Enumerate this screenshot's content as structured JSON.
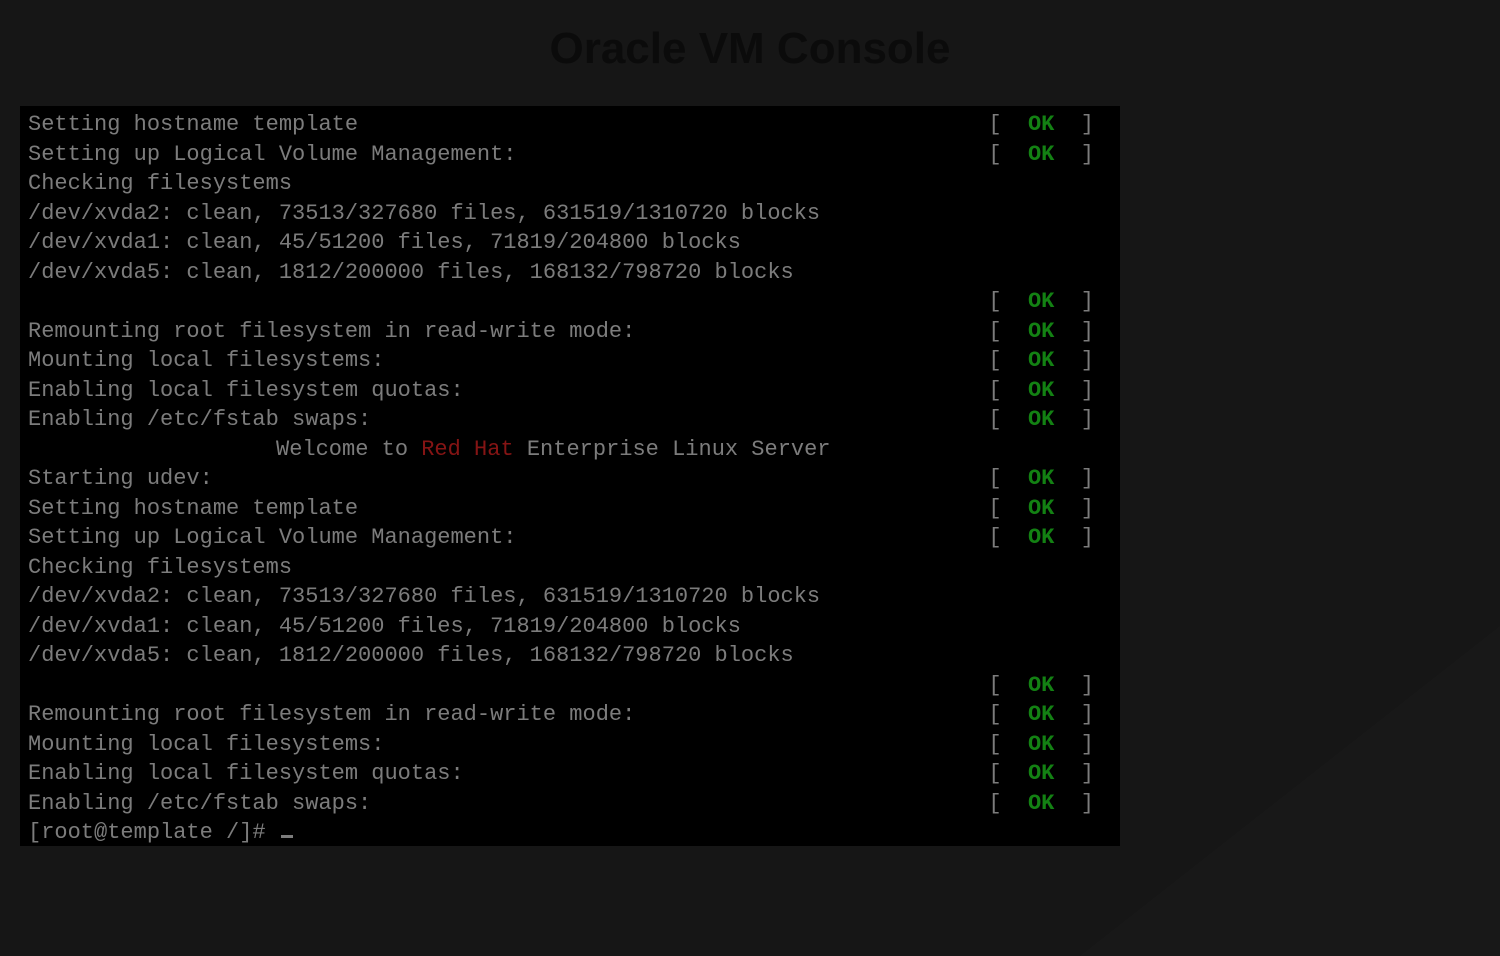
{
  "title": "Oracle VM Console",
  "status_ok": "OK",
  "bracket_open": "[",
  "bracket_close": "]",
  "welcome": {
    "prefix": "Welcome to ",
    "highlight": "Red Hat",
    "suffix": " Enterprise Linux Server"
  },
  "prompt": "[root@template /]# ",
  "lines": [
    {
      "type": "status",
      "text": "Setting hostname template",
      "status": "OK"
    },
    {
      "type": "status",
      "text": "Setting up Logical Volume Management:",
      "status": "OK"
    },
    {
      "type": "plain",
      "text": "Checking filesystems"
    },
    {
      "type": "plain",
      "text": "/dev/xvda2: clean, 73513/327680 files, 631519/1310720 blocks"
    },
    {
      "type": "plain",
      "text": "/dev/xvda1: clean, 45/51200 files, 71819/204800 blocks"
    },
    {
      "type": "plain",
      "text": "/dev/xvda5: clean, 1812/200000 files, 168132/798720 blocks"
    },
    {
      "type": "status",
      "text": "",
      "status": "OK"
    },
    {
      "type": "status",
      "text": "Remounting root filesystem in read-write mode:",
      "status": "OK"
    },
    {
      "type": "status",
      "text": "Mounting local filesystems:",
      "status": "OK"
    },
    {
      "type": "status",
      "text": "Enabling local filesystem quotas:",
      "status": "OK"
    },
    {
      "type": "status",
      "text": "Enabling /etc/fstab swaps:",
      "status": "OK"
    },
    {
      "type": "welcome"
    },
    {
      "type": "status",
      "text": "Starting udev:",
      "status": "OK"
    },
    {
      "type": "status",
      "text": "Setting hostname template",
      "status": "OK"
    },
    {
      "type": "status",
      "text": "Setting up Logical Volume Management:",
      "status": "OK"
    },
    {
      "type": "plain",
      "text": "Checking filesystems"
    },
    {
      "type": "plain",
      "text": "/dev/xvda2: clean, 73513/327680 files, 631519/1310720 blocks"
    },
    {
      "type": "plain",
      "text": "/dev/xvda1: clean, 45/51200 files, 71819/204800 blocks"
    },
    {
      "type": "plain",
      "text": "/dev/xvda5: clean, 1812/200000 files, 168132/798720 blocks"
    },
    {
      "type": "status",
      "text": "",
      "status": "OK"
    },
    {
      "type": "status",
      "text": "Remounting root filesystem in read-write mode:",
      "status": "OK"
    },
    {
      "type": "status",
      "text": "Mounting local filesystems:",
      "status": "OK"
    },
    {
      "type": "status",
      "text": "Enabling local filesystem quotas:",
      "status": "OK"
    },
    {
      "type": "status",
      "text": "Enabling /etc/fstab swaps:",
      "status": "OK"
    },
    {
      "type": "prompt"
    }
  ]
}
